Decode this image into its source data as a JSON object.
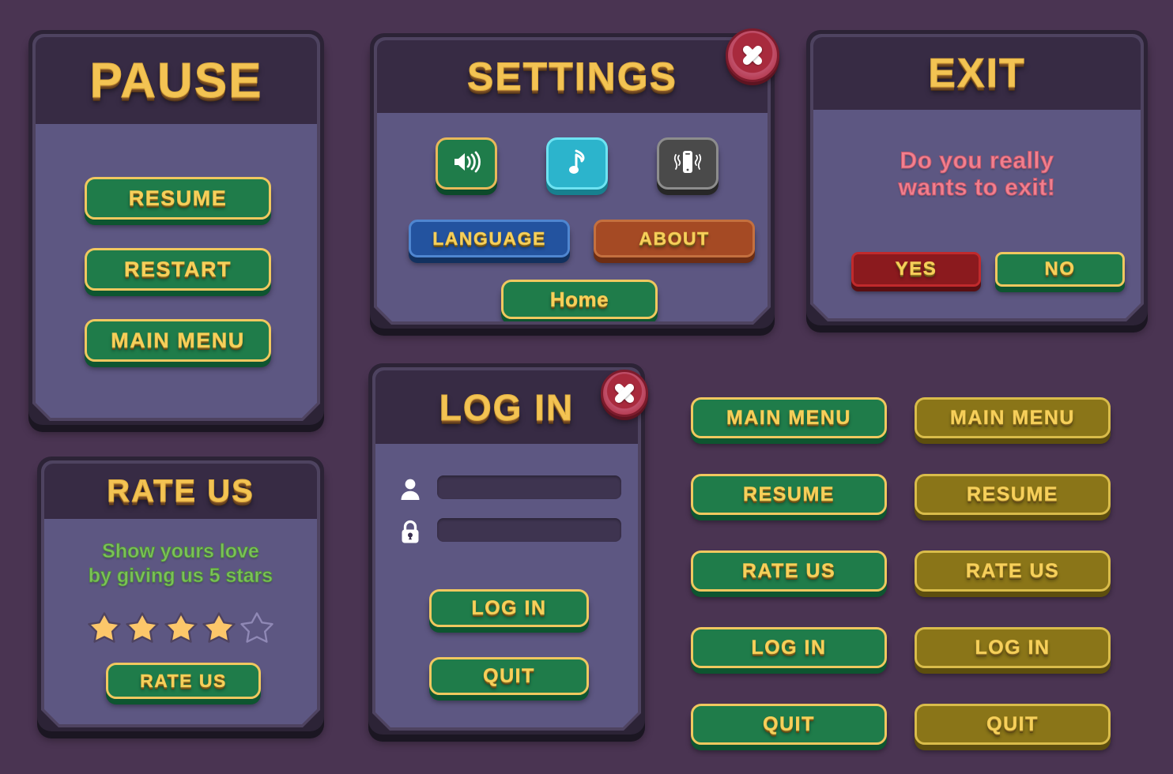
{
  "theme": {
    "background": "#4a3452",
    "panel_header": "#372b44",
    "panel_body": "#5d5782",
    "panel_frame": "#4e4360",
    "panel_shell": "#2c2336",
    "gold_text": "#f6d05c",
    "gold_border": "#f0c85f",
    "green": "#1f7c4a",
    "olive": "#8a7518",
    "blue": "#23539f",
    "orange": "#a54a24",
    "red": "#8b1a1e",
    "cyan": "#2cb4cc",
    "gray": "#4a4a4a",
    "close_red": "#a82a3d",
    "star_filled": "#fcc76a",
    "star_empty": "#6b6490",
    "exit_text": "#f2808f",
    "rate_text": "#7cc15a",
    "input_bg": "#3e3450"
  },
  "pause_panel": {
    "title": "PAUSE",
    "buttons": [
      {
        "label": "RESUME"
      },
      {
        "label": "RESTART"
      },
      {
        "label": "MAIN MENU"
      }
    ]
  },
  "settings_panel": {
    "title": "SETTINGS",
    "close_icon": "close-icon",
    "toggles": [
      {
        "icon": "sound-icon",
        "state": "on",
        "color": "#1f7c4a"
      },
      {
        "icon": "music-note-icon",
        "state": "on",
        "color": "#2cb4cc"
      },
      {
        "icon": "vibrate-icon",
        "state": "off",
        "color": "#4a4a4a"
      }
    ],
    "buttons": [
      {
        "label": "LANGUAGE",
        "style": "blue"
      },
      {
        "label": "ABOUT",
        "style": "orange"
      },
      {
        "label": "Home",
        "style": "green"
      }
    ]
  },
  "exit_panel": {
    "title": "EXIT",
    "message_line1": "Do you really",
    "message_line2": "wants to exit!",
    "yes_label": "YES",
    "no_label": "NO"
  },
  "rate_panel": {
    "title": "RATE US",
    "message_line1": "Show yours love",
    "message_line2": "by giving us 5 stars",
    "stars_total": 5,
    "stars_filled": 4,
    "button_label": "RATE US"
  },
  "login_panel": {
    "title": "LOG IN",
    "close_icon": "close-icon",
    "fields": [
      {
        "icon": "user-icon",
        "value": "",
        "placeholder": ""
      },
      {
        "icon": "lock-icon",
        "value": "",
        "placeholder": ""
      }
    ],
    "buttons": [
      {
        "label": "LOG IN"
      },
      {
        "label": "QUIT"
      }
    ]
  },
  "button_sets": {
    "green_column": [
      {
        "label": "MAIN MENU"
      },
      {
        "label": "RESUME"
      },
      {
        "label": "RATE US"
      },
      {
        "label": "LOG IN"
      },
      {
        "label": "QUIT"
      }
    ],
    "olive_column": [
      {
        "label": "MAIN MENU"
      },
      {
        "label": "RESUME"
      },
      {
        "label": "RATE US"
      },
      {
        "label": "LOG IN"
      },
      {
        "label": "QUIT"
      }
    ]
  }
}
